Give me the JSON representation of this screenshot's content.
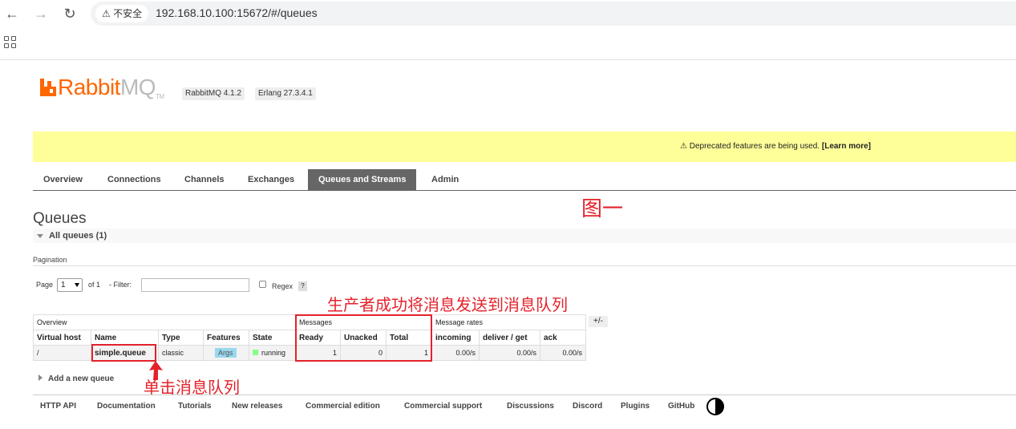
{
  "browser": {
    "security_label": "不安全",
    "url": "192.168.10.100:15672/#/queues"
  },
  "header": {
    "logo_rabbit": "Rabbit",
    "logo_mq": "MQ",
    "logo_tm": "TM",
    "version": "RabbitMQ 4.1.2",
    "erlang": "Erlang 27.3.4.1"
  },
  "warning": {
    "text": "⚠ Deprecated features are being used.",
    "link": "[Learn more]"
  },
  "tabs": [
    "Overview",
    "Connections",
    "Channels",
    "Exchanges",
    "Queues and Streams",
    "Admin"
  ],
  "page": {
    "title": "Queues",
    "section": "All queues (1)",
    "pagination_label": "Pagination",
    "page_label": "Page",
    "page_value": "1",
    "of_label": "of 1",
    "filter_label": "- Filter:",
    "regex_label": "Regex",
    "help": "?"
  },
  "table": {
    "groups": [
      "Overview",
      "Messages",
      "Message rates"
    ],
    "plus_minus": "+/-",
    "headers": [
      "Virtual host",
      "Name",
      "Type",
      "Features",
      "State",
      "Ready",
      "Unacked",
      "Total",
      "incoming",
      "deliver / get",
      "ack"
    ],
    "row": {
      "vhost": "/",
      "name": "simple.queue",
      "type": "classic",
      "features": "Args",
      "state": "running",
      "ready": "1",
      "unacked": "0",
      "total": "1",
      "incoming": "0.00/s",
      "deliver_get": "0.00/s",
      "ack": "0.00/s"
    }
  },
  "add_queue": "Add a new queue",
  "footer": [
    "HTTP API",
    "Documentation",
    "Tutorials",
    "New releases",
    "Commercial edition",
    "Commercial support",
    "Discussions",
    "Discord",
    "Plugins",
    "GitHub"
  ],
  "annotations": {
    "figure": "图一",
    "messages_note": "生产者成功将消息发送到消息队列",
    "click_note": "单击消息队列",
    "color": "#e4222b"
  }
}
